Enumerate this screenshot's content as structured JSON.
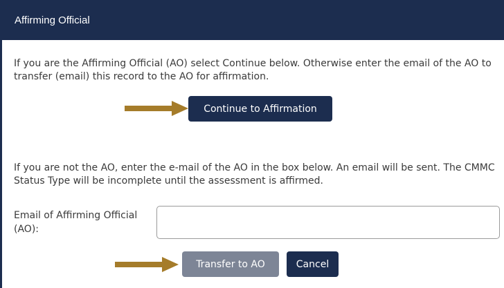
{
  "dialog": {
    "title": "Affirming Official"
  },
  "section_self": {
    "instructions": "If you are the Affirming Official (AO) select Continue below. Otherwise enter the email of the AO to transfer (email) this record to the AO for affirmation.",
    "continue_label": "Continue to Affirmation"
  },
  "section_transfer": {
    "instructions": "If you are not the AO, enter the e-mail of the AO in the box below. An email will be sent. The CMMC Status Type will be incomplete until the assessment is affirmed.",
    "email_label": "Email of Affirming Official (AO):",
    "email_value": "",
    "transfer_label": "Transfer to AO",
    "cancel_label": "Cancel"
  },
  "colors": {
    "title_bar": "#1c2d4f",
    "primary_button": "#1c2d4f",
    "disabled_button": "#7d8596",
    "arrow": "#a57c2a"
  },
  "icons": [
    "arrow-right-icon"
  ]
}
